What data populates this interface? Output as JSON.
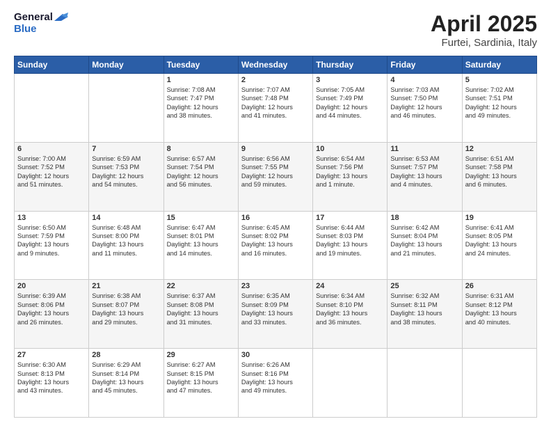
{
  "header": {
    "logo_general": "General",
    "logo_blue": "Blue",
    "title": "April 2025",
    "subtitle": "Furtei, Sardinia, Italy"
  },
  "columns": [
    "Sunday",
    "Monday",
    "Tuesday",
    "Wednesday",
    "Thursday",
    "Friday",
    "Saturday"
  ],
  "weeks": [
    [
      {
        "num": "",
        "lines": []
      },
      {
        "num": "",
        "lines": []
      },
      {
        "num": "1",
        "lines": [
          "Sunrise: 7:08 AM",
          "Sunset: 7:47 PM",
          "Daylight: 12 hours",
          "and 38 minutes."
        ]
      },
      {
        "num": "2",
        "lines": [
          "Sunrise: 7:07 AM",
          "Sunset: 7:48 PM",
          "Daylight: 12 hours",
          "and 41 minutes."
        ]
      },
      {
        "num": "3",
        "lines": [
          "Sunrise: 7:05 AM",
          "Sunset: 7:49 PM",
          "Daylight: 12 hours",
          "and 44 minutes."
        ]
      },
      {
        "num": "4",
        "lines": [
          "Sunrise: 7:03 AM",
          "Sunset: 7:50 PM",
          "Daylight: 12 hours",
          "and 46 minutes."
        ]
      },
      {
        "num": "5",
        "lines": [
          "Sunrise: 7:02 AM",
          "Sunset: 7:51 PM",
          "Daylight: 12 hours",
          "and 49 minutes."
        ]
      }
    ],
    [
      {
        "num": "6",
        "lines": [
          "Sunrise: 7:00 AM",
          "Sunset: 7:52 PM",
          "Daylight: 12 hours",
          "and 51 minutes."
        ]
      },
      {
        "num": "7",
        "lines": [
          "Sunrise: 6:59 AM",
          "Sunset: 7:53 PM",
          "Daylight: 12 hours",
          "and 54 minutes."
        ]
      },
      {
        "num": "8",
        "lines": [
          "Sunrise: 6:57 AM",
          "Sunset: 7:54 PM",
          "Daylight: 12 hours",
          "and 56 minutes."
        ]
      },
      {
        "num": "9",
        "lines": [
          "Sunrise: 6:56 AM",
          "Sunset: 7:55 PM",
          "Daylight: 12 hours",
          "and 59 minutes."
        ]
      },
      {
        "num": "10",
        "lines": [
          "Sunrise: 6:54 AM",
          "Sunset: 7:56 PM",
          "Daylight: 13 hours",
          "and 1 minute."
        ]
      },
      {
        "num": "11",
        "lines": [
          "Sunrise: 6:53 AM",
          "Sunset: 7:57 PM",
          "Daylight: 13 hours",
          "and 4 minutes."
        ]
      },
      {
        "num": "12",
        "lines": [
          "Sunrise: 6:51 AM",
          "Sunset: 7:58 PM",
          "Daylight: 13 hours",
          "and 6 minutes."
        ]
      }
    ],
    [
      {
        "num": "13",
        "lines": [
          "Sunrise: 6:50 AM",
          "Sunset: 7:59 PM",
          "Daylight: 13 hours",
          "and 9 minutes."
        ]
      },
      {
        "num": "14",
        "lines": [
          "Sunrise: 6:48 AM",
          "Sunset: 8:00 PM",
          "Daylight: 13 hours",
          "and 11 minutes."
        ]
      },
      {
        "num": "15",
        "lines": [
          "Sunrise: 6:47 AM",
          "Sunset: 8:01 PM",
          "Daylight: 13 hours",
          "and 14 minutes."
        ]
      },
      {
        "num": "16",
        "lines": [
          "Sunrise: 6:45 AM",
          "Sunset: 8:02 PM",
          "Daylight: 13 hours",
          "and 16 minutes."
        ]
      },
      {
        "num": "17",
        "lines": [
          "Sunrise: 6:44 AM",
          "Sunset: 8:03 PM",
          "Daylight: 13 hours",
          "and 19 minutes."
        ]
      },
      {
        "num": "18",
        "lines": [
          "Sunrise: 6:42 AM",
          "Sunset: 8:04 PM",
          "Daylight: 13 hours",
          "and 21 minutes."
        ]
      },
      {
        "num": "19",
        "lines": [
          "Sunrise: 6:41 AM",
          "Sunset: 8:05 PM",
          "Daylight: 13 hours",
          "and 24 minutes."
        ]
      }
    ],
    [
      {
        "num": "20",
        "lines": [
          "Sunrise: 6:39 AM",
          "Sunset: 8:06 PM",
          "Daylight: 13 hours",
          "and 26 minutes."
        ]
      },
      {
        "num": "21",
        "lines": [
          "Sunrise: 6:38 AM",
          "Sunset: 8:07 PM",
          "Daylight: 13 hours",
          "and 29 minutes."
        ]
      },
      {
        "num": "22",
        "lines": [
          "Sunrise: 6:37 AM",
          "Sunset: 8:08 PM",
          "Daylight: 13 hours",
          "and 31 minutes."
        ]
      },
      {
        "num": "23",
        "lines": [
          "Sunrise: 6:35 AM",
          "Sunset: 8:09 PM",
          "Daylight: 13 hours",
          "and 33 minutes."
        ]
      },
      {
        "num": "24",
        "lines": [
          "Sunrise: 6:34 AM",
          "Sunset: 8:10 PM",
          "Daylight: 13 hours",
          "and 36 minutes."
        ]
      },
      {
        "num": "25",
        "lines": [
          "Sunrise: 6:32 AM",
          "Sunset: 8:11 PM",
          "Daylight: 13 hours",
          "and 38 minutes."
        ]
      },
      {
        "num": "26",
        "lines": [
          "Sunrise: 6:31 AM",
          "Sunset: 8:12 PM",
          "Daylight: 13 hours",
          "and 40 minutes."
        ]
      }
    ],
    [
      {
        "num": "27",
        "lines": [
          "Sunrise: 6:30 AM",
          "Sunset: 8:13 PM",
          "Daylight: 13 hours",
          "and 43 minutes."
        ]
      },
      {
        "num": "28",
        "lines": [
          "Sunrise: 6:29 AM",
          "Sunset: 8:14 PM",
          "Daylight: 13 hours",
          "and 45 minutes."
        ]
      },
      {
        "num": "29",
        "lines": [
          "Sunrise: 6:27 AM",
          "Sunset: 8:15 PM",
          "Daylight: 13 hours",
          "and 47 minutes."
        ]
      },
      {
        "num": "30",
        "lines": [
          "Sunrise: 6:26 AM",
          "Sunset: 8:16 PM",
          "Daylight: 13 hours",
          "and 49 minutes."
        ]
      },
      {
        "num": "",
        "lines": []
      },
      {
        "num": "",
        "lines": []
      },
      {
        "num": "",
        "lines": []
      }
    ]
  ]
}
